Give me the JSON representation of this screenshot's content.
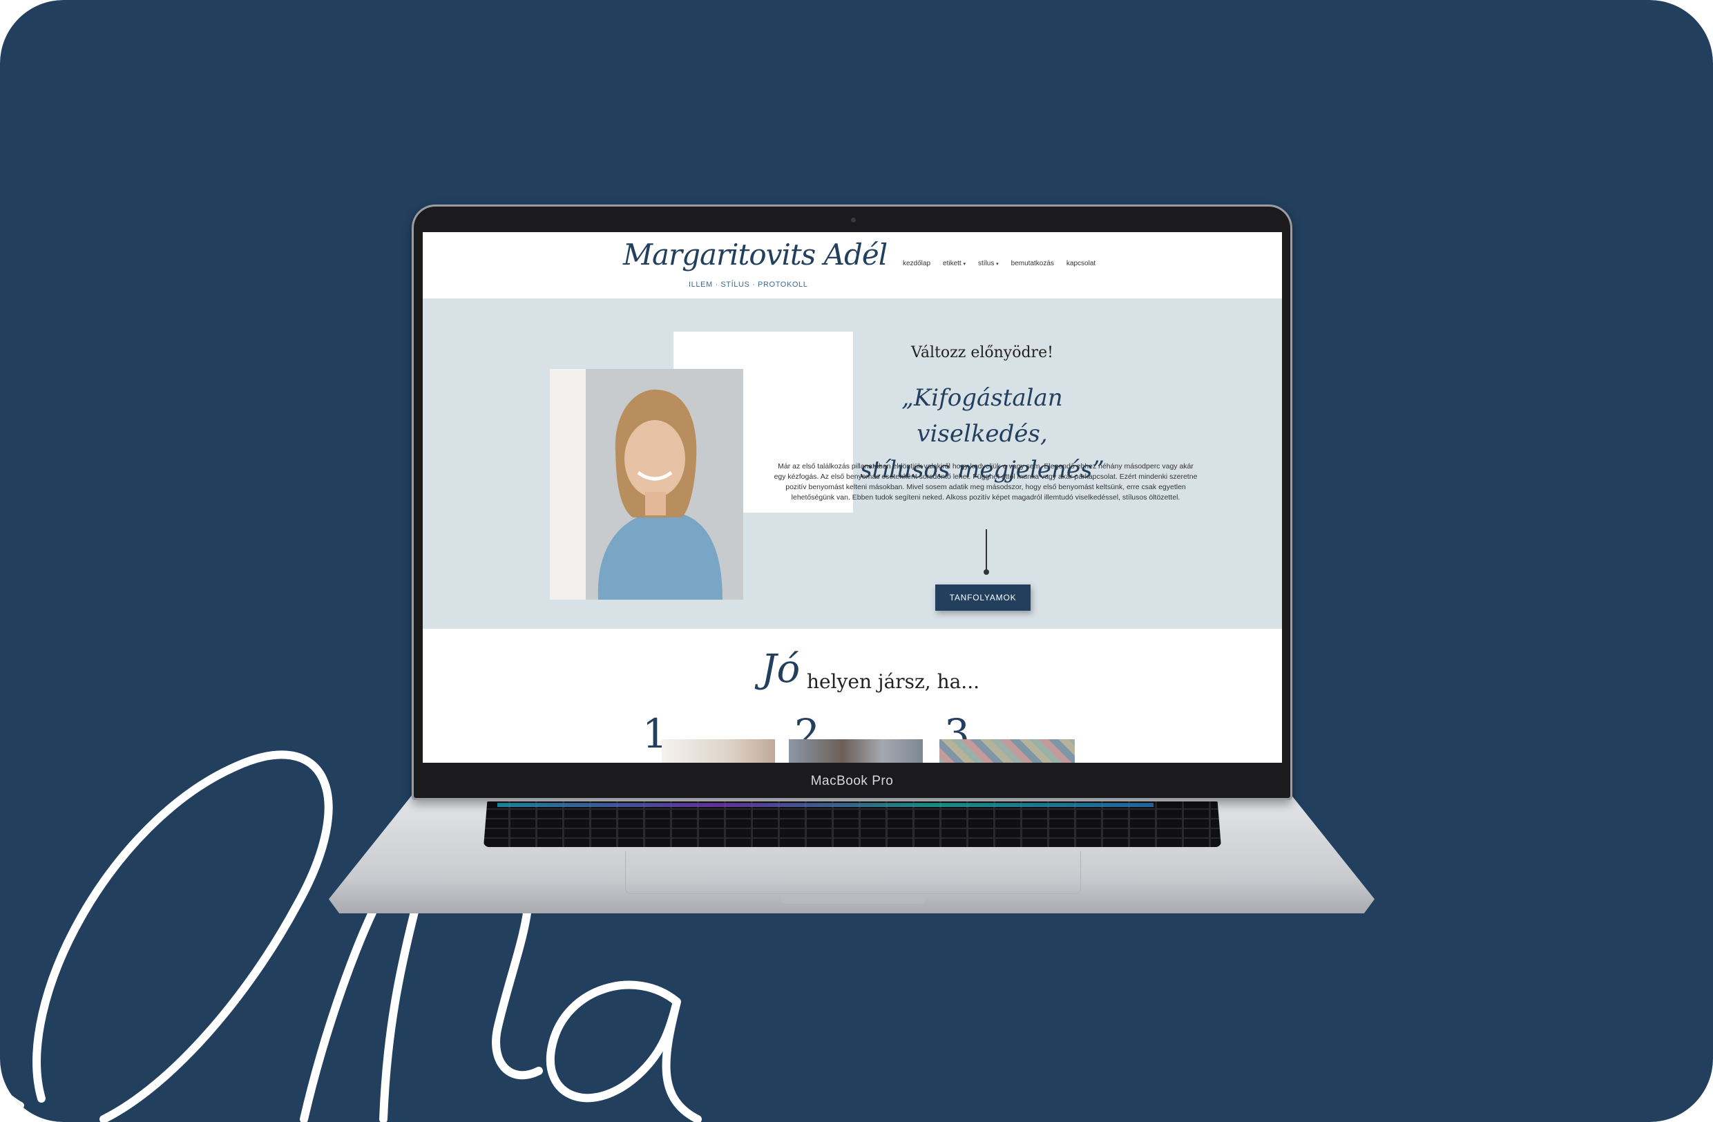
{
  "colors": {
    "background": "#223f5e",
    "accent": "#223f5e",
    "hero_bg": "#d7e1e6"
  },
  "background_script": "Ona",
  "device": {
    "label": "MacBook Pro"
  },
  "site": {
    "logo": {
      "name": "Margaritovits Adél",
      "tagline": "ILLEM · STÍLUS · PROTOKOLL"
    },
    "nav": [
      {
        "label": "kezdőlap",
        "has_dropdown": false
      },
      {
        "label": "etikett",
        "has_dropdown": true
      },
      {
        "label": "stílus",
        "has_dropdown": true
      },
      {
        "label": "bemutatkozás",
        "has_dropdown": false
      },
      {
        "label": "kapcsolat",
        "has_dropdown": false
      }
    ],
    "hero": {
      "subtitle": "Változz előnyödre!",
      "quote_line1": "„Kifogástalan viselkedés,",
      "quote_line2": "stílusos megjelenés”",
      "body": "Már az első találkozás pillanatában eldöntjük valakiről hogy kedveljük-e vagy sem. Elegendő ehhez néhány másodperc vagy akár egy kézfogás. Az első benyomás esetenként sorsdöntő lehet. Függhet ettől munka vagy akár párkapcsolat. Ezért mindenki szeretne pozitív benyomást kelteni másokban. Mivel sosem adatik meg másodszor, hogy első benyomást keltsünk, erre csak egyetlen lehetőségünk van. Ebben tudok segíteni neked. Alkoss pozitív képet magadról illemtudó viselkedéssel, stílusos öltözettel.",
      "button": "TANFOLYAMOK"
    },
    "section2": {
      "title_script": "Jó",
      "title_rest": "helyen jársz, ha...",
      "items": [
        {
          "number": "1"
        },
        {
          "number": "2"
        },
        {
          "number": "3"
        }
      ]
    }
  }
}
